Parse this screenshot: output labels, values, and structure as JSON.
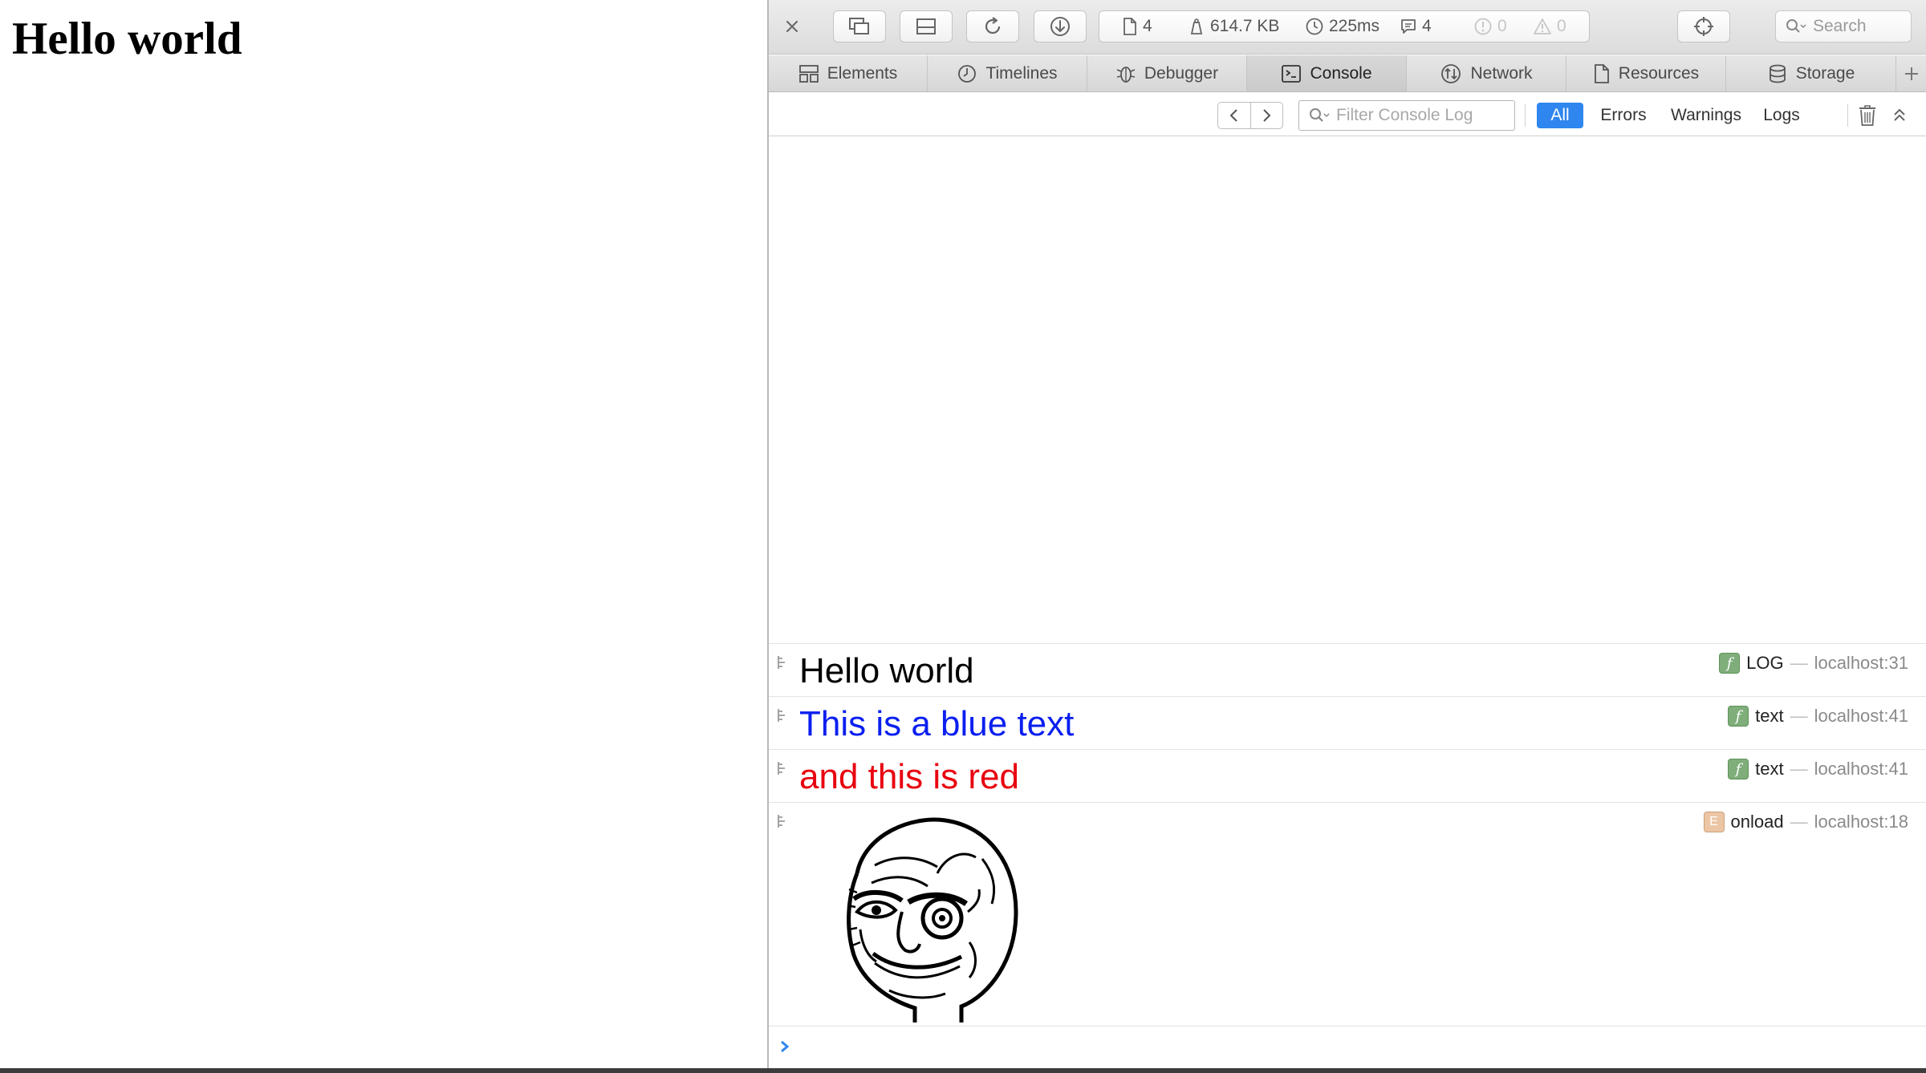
{
  "page": {
    "heading": "Hello world"
  },
  "toolbar": {
    "stats": {
      "resources": "4",
      "size": "614.7 KB",
      "load_time": "225ms",
      "logs": "4",
      "errors": "0",
      "warnings": "0"
    },
    "search_label": "Search"
  },
  "tabs": [
    {
      "label": "Elements",
      "icon": "elements-icon"
    },
    {
      "label": "Timelines",
      "icon": "timelines-icon"
    },
    {
      "label": "Debugger",
      "icon": "debugger-icon"
    },
    {
      "label": "Console",
      "icon": "console-icon",
      "active": true
    },
    {
      "label": "Network",
      "icon": "network-icon"
    },
    {
      "label": "Resources",
      "icon": "resources-icon"
    },
    {
      "label": "Storage",
      "icon": "storage-icon"
    }
  ],
  "filterbar": {
    "placeholder": "Filter Console Log",
    "filters": [
      "All",
      "Errors",
      "Warnings",
      "Logs"
    ],
    "active_filter": "All"
  },
  "console": {
    "messages": [
      {
        "text": "Hello world",
        "color": "#000000",
        "badge": "function",
        "kind": "LOG",
        "location": "localhost:31"
      },
      {
        "text": "This is a blue text",
        "color": "#0a1ff0",
        "badge": "function",
        "kind": "text",
        "location": "localhost:41"
      },
      {
        "text": "and this is red",
        "color": "#e8000f",
        "badge": "function",
        "kind": "text",
        "location": "localhost:41"
      },
      {
        "text": "",
        "image": "rage-face",
        "badge": "event",
        "kind": "onload",
        "location": "localhost:18"
      }
    ],
    "separator": "—"
  },
  "colors": {
    "accent": "#2f86ef",
    "blue_text": "#0a1ff0",
    "red_text": "#e8000f"
  }
}
